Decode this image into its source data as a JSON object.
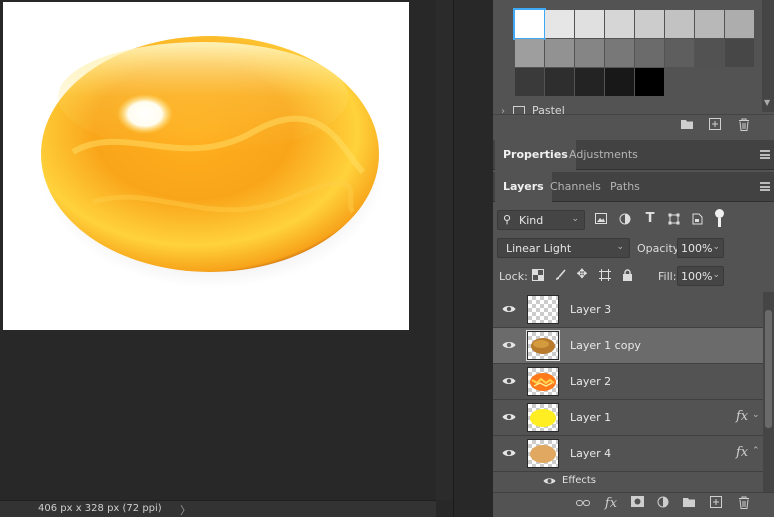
{
  "status_bar": {
    "doc_size": "406 px x 328 px (72 ppi)",
    "arrow": "〉"
  },
  "swatches": {
    "group_label": "Pastel",
    "colors": [
      "#ffffff",
      "#e6e6e6",
      "#e0e0e0",
      "#d6d6d6",
      "#cccccc",
      "#c2c2c2",
      "#b8b8b8",
      "#adadad",
      "#9e9e9e",
      "#929292",
      "#858585",
      "#787878",
      "#6b6b6b",
      "#5e5e5e",
      "#525252",
      "#474747",
      "#3a3a3a",
      "#2e2e2e",
      "#232323",
      "#181818",
      "#000000"
    ]
  },
  "properties_tabs": {
    "properties": "Properties",
    "adjustments": "Adjustments"
  },
  "layers_tabs": {
    "layers": "Layers",
    "channels": "Channels",
    "paths": "Paths"
  },
  "filter": {
    "kind": "Kind"
  },
  "blend": {
    "mode": "Linear Light",
    "opacity_label": "Opacity:",
    "opacity_value": "100%"
  },
  "lock": {
    "label": "Lock:",
    "fill_label": "Fill:",
    "fill_value": "100%"
  },
  "layers": [
    {
      "name": "Layer 3",
      "thumb": "empty",
      "fx": false,
      "selected": false
    },
    {
      "name": "Layer 1 copy",
      "thumb": "brown-ellipse",
      "fx": false,
      "selected": true
    },
    {
      "name": "Layer 2",
      "thumb": "orange-pattern",
      "fx": false,
      "selected": false
    },
    {
      "name": "Layer 1",
      "thumb": "yellow-ellipse",
      "fx": true,
      "selected": false
    },
    {
      "name": "Layer 4",
      "thumb": "tan-ellipse",
      "fx": true,
      "selected": false
    }
  ],
  "effects_label": "Effects",
  "fx_label": "fx",
  "colors": {
    "panel_bg": "#535353",
    "selected_row": "#6b6b6b",
    "swatch_highlight": "#3fa9f5"
  }
}
